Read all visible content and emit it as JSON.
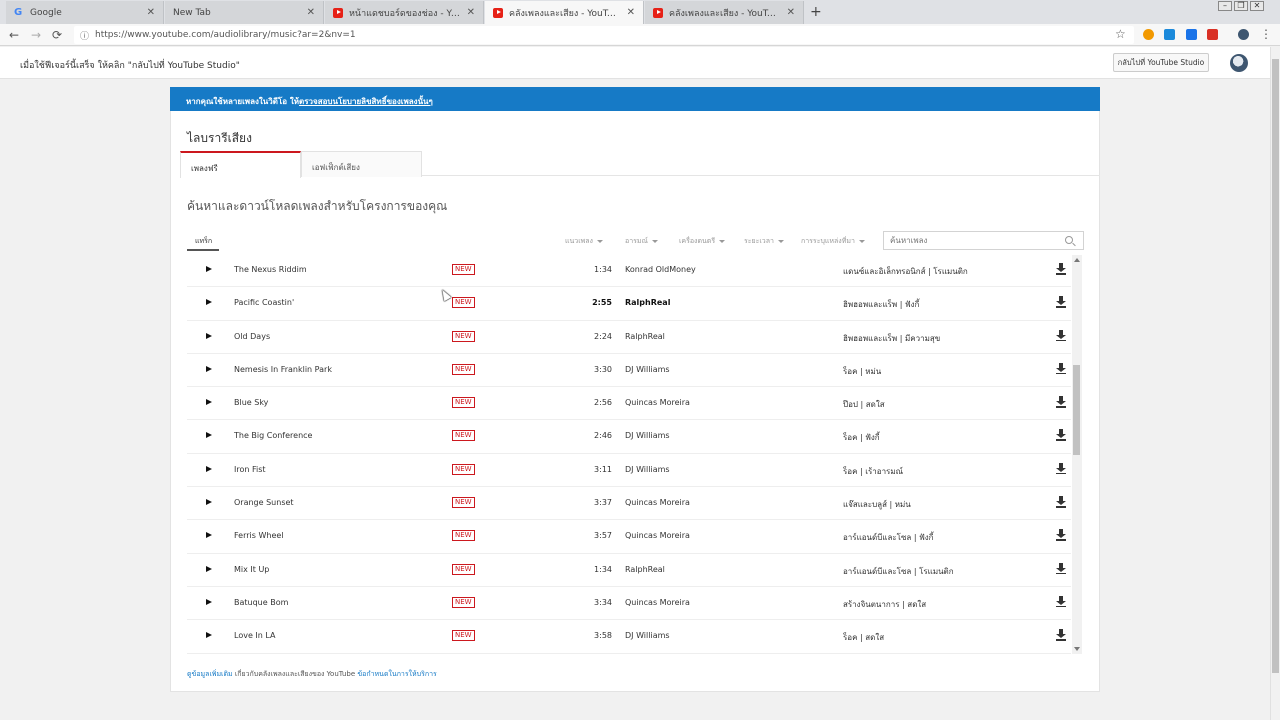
{
  "browser": {
    "tabs": [
      {
        "title": "Google",
        "favicon": "google-icon",
        "active": false
      },
      {
        "title": "New Tab",
        "favicon": "none",
        "active": false
      },
      {
        "title": "หน้าแดชบอร์ดของช่อง - YouTube St",
        "favicon": "youtube-icon",
        "active": false
      },
      {
        "title": "คลังเพลงและเสียง - YouTube",
        "favicon": "youtube-icon",
        "active": true
      },
      {
        "title": "คลังเพลงและเสียง - YouTube",
        "favicon": "youtube-icon",
        "active": false
      }
    ],
    "url": "https://www.youtube.com/audiolibrary/music?ar=2&nv=1"
  },
  "notice": {
    "text": "เมื่อใช้ฟีเจอร์นี้เสร็จ ให้คลิก \"กลับไปที่ YouTube Studio\"",
    "button": "กลับไปที่ YouTube Studio"
  },
  "banner": {
    "prefix": "หากคุณใช้หลายเพลงในวิดีโอ ให้",
    "link": "ตรวจสอบนโยบายลิขสิทธิ์ของเพลงนั้นๆ"
  },
  "library": {
    "title": "ไลบรารีเสียง",
    "tabs": [
      "เพลงฟรี",
      "เอฟเฟ็กต์เสียง"
    ],
    "subtitle": "ค้นหาและดาวน์โหลดเพลงสำหรับโครงการของคุณ"
  },
  "filters": {
    "tab": "แทร็ก",
    "dropdowns": [
      "แนวเพลง",
      "อารมณ์",
      "เครื่องดนตรี",
      "ระยะเวลา",
      "การระบุแหล่งที่มา"
    ],
    "search_placeholder": "ค้นหาเพลง"
  },
  "badge_label": "NEW",
  "tracks": [
    {
      "title": "The Nexus Riddim",
      "duration": "1:34",
      "artist": "Konrad OldMoney",
      "genre": "แดนซ์และอิเล็กทรอนิกส์ | โรแมนติก"
    },
    {
      "title": "Pacific Coastin'",
      "duration": "2:55",
      "artist": "RalphReal",
      "genre": "ฮิพฮอพและแร็พ | ฟังกี้"
    },
    {
      "title": "Old Days",
      "duration": "2:24",
      "artist": "RalphReal",
      "genre": "ฮิพฮอพและแร็พ | มีความสุข"
    },
    {
      "title": "Nemesis In Franklin Park",
      "duration": "3:30",
      "artist": "DJ Williams",
      "genre": "ร็อค | หม่น"
    },
    {
      "title": "Blue Sky",
      "duration": "2:56",
      "artist": "Quincas Moreira",
      "genre": "ป๊อป | สดใส"
    },
    {
      "title": "The Big Conference",
      "duration": "2:46",
      "artist": "DJ Williams",
      "genre": "ร็อค | ฟังกี้"
    },
    {
      "title": "Iron Fist",
      "duration": "3:11",
      "artist": "DJ Williams",
      "genre": "ร็อค | เร้าอารมณ์"
    },
    {
      "title": "Orange Sunset",
      "duration": "3:37",
      "artist": "Quincas Moreira",
      "genre": "แจ๊สและบลูส์ | หม่น"
    },
    {
      "title": "Ferris Wheel",
      "duration": "3:57",
      "artist": "Quincas Moreira",
      "genre": "อาร์แอนด์บีและโซล | ฟังกี้"
    },
    {
      "title": "Mix It Up",
      "duration": "1:34",
      "artist": "RalphReal",
      "genre": "อาร์แอนด์บีและโซล | โรแมนติก"
    },
    {
      "title": "Batuque Bom",
      "duration": "3:34",
      "artist": "Quincas Moreira",
      "genre": "สร้างจินตนาการ | สดใส"
    },
    {
      "title": "Love In LA",
      "duration": "3:58",
      "artist": "DJ Williams",
      "genre": "ร็อค | สดใส"
    }
  ],
  "footer": {
    "link1": "ดูข้อมูลเพิ่มเติม",
    "middle": "เกี่ยวกับคลังเพลงและเสียงของ YouTube",
    "link2": "ข้อกำหนดในการให้บริการ"
  },
  "colors": {
    "accent": "#167ac6",
    "brand_red": "#cc181e"
  }
}
